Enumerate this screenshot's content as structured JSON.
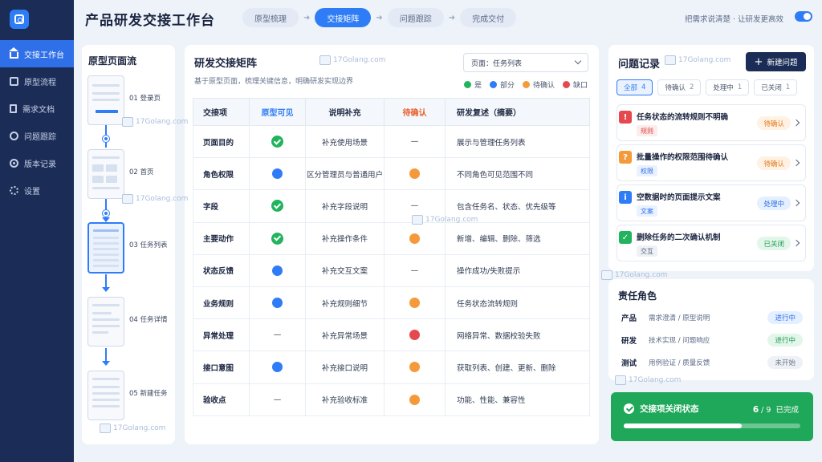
{
  "app": {
    "title": "产品研发交接工作台",
    "tagline": "把需求说清楚 · 让研发更高效"
  },
  "sidebar": {
    "items": [
      {
        "label": "交接工作台",
        "icon": "home-icon"
      },
      {
        "label": "原型流程",
        "icon": "flow-icon"
      },
      {
        "label": "需求文档",
        "icon": "document-icon"
      },
      {
        "label": "问题跟踪",
        "icon": "bug-icon"
      },
      {
        "label": "版本记录",
        "icon": "version-icon"
      },
      {
        "label": "设置",
        "icon": "gear-icon"
      }
    ]
  },
  "steps": [
    "原型梳理",
    "交接矩阵",
    "问题跟踪",
    "完成交付"
  ],
  "flow": {
    "title": "原型页面流",
    "pages": [
      {
        "label": "01 登录页"
      },
      {
        "label": "02 首页"
      },
      {
        "label": "03 任务列表"
      },
      {
        "label": "04 任务详情"
      },
      {
        "label": "05 新建任务"
      }
    ]
  },
  "matrix": {
    "title": "研发交接矩阵",
    "subtitle": "基于原型页面，梳理关键信息，明确研发实现边界",
    "select_value": "页面：任务列表",
    "legend": [
      {
        "label": "是",
        "color": "#22b35e"
      },
      {
        "label": "部分",
        "color": "#2f7df6"
      },
      {
        "label": "待确认",
        "color": "#f59a3b"
      },
      {
        "label": "缺口",
        "color": "#e5484d"
      }
    ],
    "headers": [
      "交接项",
      "原型可见",
      "说明补充",
      "待确认",
      "研发复述（摘要）"
    ],
    "header_colors": {
      "visible": "#2f7df6",
      "pending": "#e8602c"
    },
    "rows": [
      {
        "item": "页面目的",
        "visible": "是",
        "note": "补充使用场景",
        "pending": "—",
        "recap": "展示与管理任务列表"
      },
      {
        "item": "角色权限",
        "visible": "部分",
        "note": "区分管理员与普通用户",
        "pending": "待确认",
        "recap": "不同角色可见范围不同"
      },
      {
        "item": "字段",
        "visible": "是",
        "note": "补充字段说明",
        "pending": "—",
        "recap": "包含任务名、状态、优先级等"
      },
      {
        "item": "主要动作",
        "visible": "是",
        "note": "补充操作条件",
        "pending": "待确认",
        "recap": "新增、编辑、删除、筛选"
      },
      {
        "item": "状态反馈",
        "visible": "部分",
        "note": "补充交互文案",
        "pending": "—",
        "recap": "操作成功/失败提示"
      },
      {
        "item": "业务规则",
        "visible": "部分",
        "note": "补充规则细节",
        "pending": "待确认",
        "recap": "任务状态流转规则"
      },
      {
        "item": "异常处理",
        "visible": "—",
        "note": "补充异常场景",
        "pending": "缺口",
        "recap": "网络异常、数据校验失败"
      },
      {
        "item": "接口意图",
        "visible": "部分",
        "note": "补充接口说明",
        "pending": "待确认",
        "recap": "获取列表、创建、更新、删除"
      },
      {
        "item": "验收点",
        "visible": "—",
        "note": "补充验收标准",
        "pending": "待确认",
        "recap": "功能、性能、兼容性"
      }
    ]
  },
  "issues": {
    "title": "问题记录",
    "new_label": "新建问题",
    "filters": [
      {
        "label": "全部",
        "count": "4"
      },
      {
        "label": "待确认",
        "count": "2"
      },
      {
        "label": "处理中",
        "count": "1"
      },
      {
        "label": "已关闭",
        "count": "1"
      }
    ],
    "items": [
      {
        "glyph": "!",
        "glyph_color": "#e5484d",
        "text": "任务状态的流转规则不明确",
        "tag": "规则",
        "tag_bg": "#fdecec",
        "tag_color": "#d9443f",
        "status": "待确认",
        "status_bg": "#fff1e3",
        "status_color": "#e07b1f"
      },
      {
        "glyph": "?",
        "glyph_color": "#f59a3b",
        "text": "批量操作的权限范围待确认",
        "tag": "权限",
        "tag_bg": "#eaf2ff",
        "tag_color": "#2f6fe8",
        "status": "待确认",
        "status_bg": "#fff1e3",
        "status_color": "#e07b1f"
      },
      {
        "glyph": "i",
        "glyph_color": "#2f7df6",
        "text": "空数据时的页面提示文案",
        "tag": "文案",
        "tag_bg": "#eaf2ff",
        "tag_color": "#2f6fe8",
        "status": "处理中",
        "status_bg": "#e4efff",
        "status_color": "#2f6fe8"
      },
      {
        "glyph": "✓",
        "glyph_color": "#22b35e",
        "text": "删除任务的二次确认机制",
        "tag": "交互",
        "tag_bg": "#eef1f5",
        "tag_color": "#56627a",
        "status": "已关闭",
        "status_bg": "#e3f6ea",
        "status_color": "#1f9a55"
      }
    ]
  },
  "roles": {
    "title": "责任角色",
    "items": [
      {
        "name": "产品",
        "desc": "需求澄清 / 原型说明",
        "status": "进行中",
        "bg": "#e4efff",
        "color": "#2f6fe8"
      },
      {
        "name": "研发",
        "desc": "技术实现 / 问题响应",
        "status": "进行中",
        "bg": "#e3f6ea",
        "color": "#1f9a55"
      },
      {
        "name": "测试",
        "desc": "用例验证 / 质量反馈",
        "status": "未开始",
        "bg": "#eef1f5",
        "color": "#6b778c"
      }
    ]
  },
  "progress": {
    "title": "交接项关闭状态",
    "done": "6",
    "total": "9",
    "suffix": "已完成",
    "fraction": 0.667
  },
  "watermark": "17Golang.com"
}
